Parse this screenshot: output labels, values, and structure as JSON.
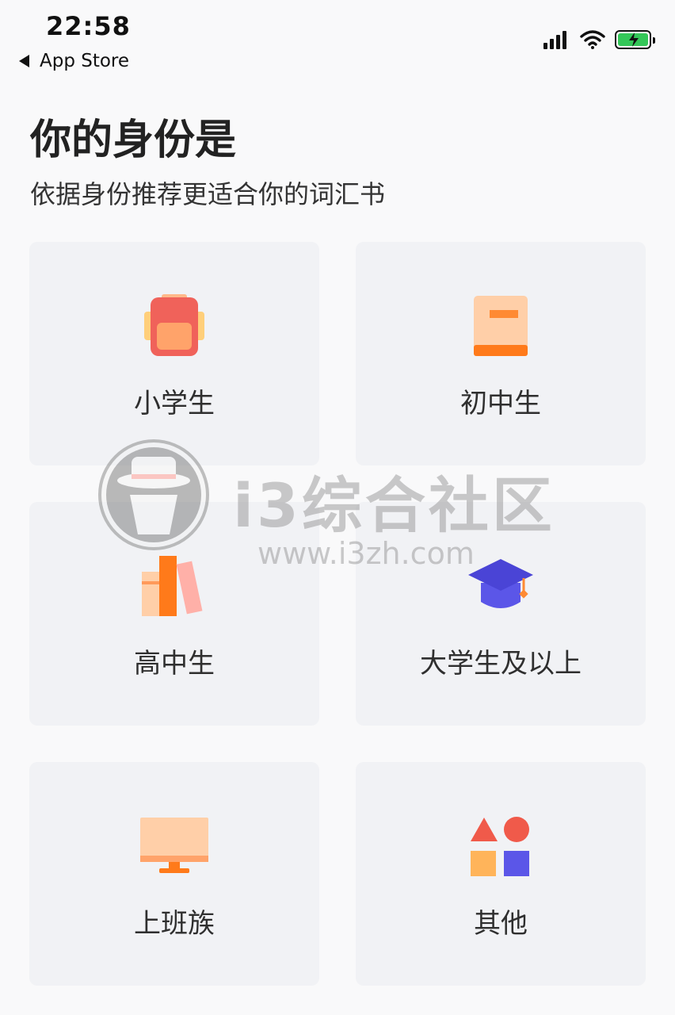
{
  "status_bar": {
    "time": "22:58",
    "back_label": "App Store"
  },
  "header": {
    "title": "你的身份是",
    "subtitle": "依据身份推荐更适合你的词汇书"
  },
  "options": [
    {
      "label": "小学生",
      "icon": "backpack-icon"
    },
    {
      "label": "初中生",
      "icon": "book-icon"
    },
    {
      "label": "高中生",
      "icon": "books-stack-icon"
    },
    {
      "label": "大学生及以上",
      "icon": "graduation-cap-icon"
    },
    {
      "label": "上班族",
      "icon": "monitor-icon"
    },
    {
      "label": "其他",
      "icon": "shapes-icon"
    }
  ],
  "watermark": {
    "text": "i3综合社区",
    "url": "www.i3zh.com"
  },
  "colors": {
    "background": "#f9f9fa",
    "card": "#f1f2f5",
    "orange": "#ff7a1a",
    "peach": "#ffcfa8",
    "coral": "#f05a4a",
    "purple": "#5b56e8",
    "battery_green": "#34c759"
  }
}
